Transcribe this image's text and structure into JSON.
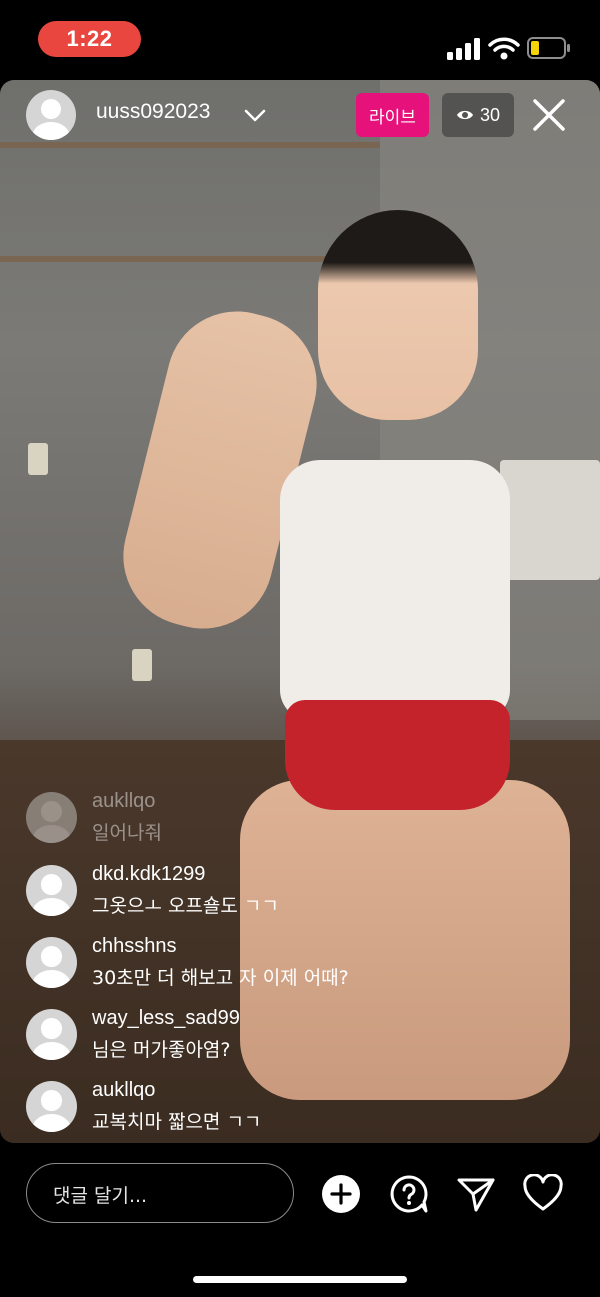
{
  "status_bar": {
    "time": "1:22"
  },
  "header": {
    "username": "uuss092023",
    "live_label": "라이브",
    "viewer_count": "30"
  },
  "comments": [
    {
      "user": "aukllqo",
      "text": "일어나줘"
    },
    {
      "user": "dkd.kdk1299",
      "text": "그옷으ㅗ 오프숄도 ㄱㄱ"
    },
    {
      "user": "chhsshns",
      "text": "30초만 더 해보고 자 이제 어때?"
    },
    {
      "user": "way_less_sad99",
      "text": "님은 머가좋아염?"
    },
    {
      "user": "aukllqo",
      "text": "교복치마 짧으면 ㄱㄱ"
    }
  ],
  "footer": {
    "comment_placeholder": "댓글 달기..."
  }
}
